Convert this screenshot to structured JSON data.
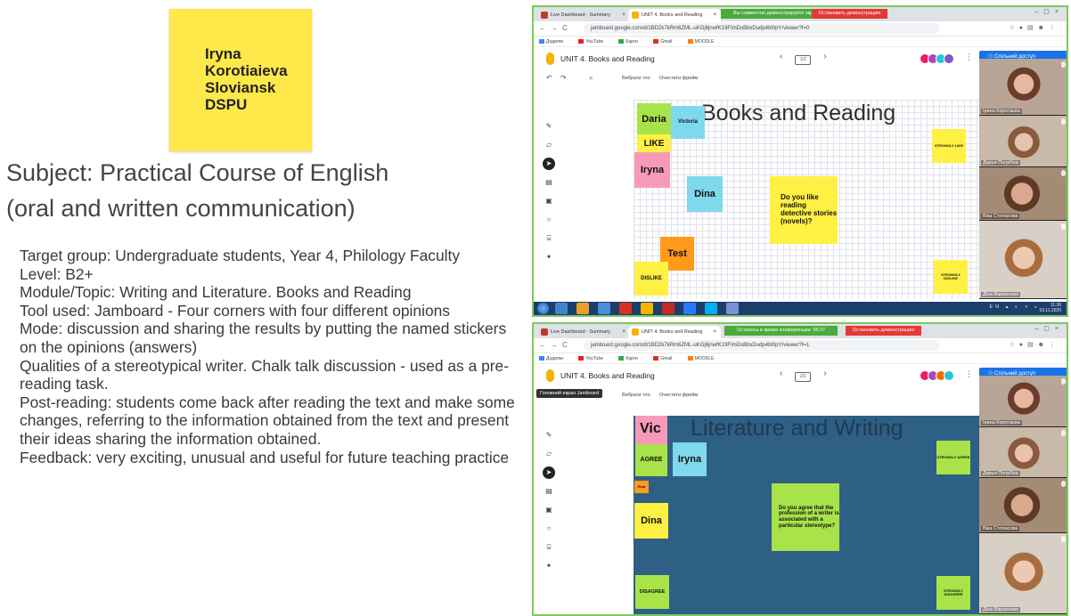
{
  "author": {
    "name_line1": "Iryna",
    "name_line2": "Korotiaieva",
    "affiliation_line1": "Sloviansk",
    "affiliation_line2": "DSPU"
  },
  "subject": {
    "line1": "Subject: Practical Course of English",
    "line2": "(oral and written communication)"
  },
  "details": [
    "Target group: Undergraduate students, Year 4, Philology Faculty",
    "Level: B2+",
    "Module/Topic: Writing and Literature. Books and Reading",
    "Tool used: Jamboard - Four corners with four different opinions",
    "Mode: discussion and sharing the results by putting the named stickers on the opinions (answers)",
    "Qualities of a stereotypical writer. Chalk talk discussion - used as a pre-reading task.",
    "Post-reading:  students come back after reading the text and make some changes, referring to the information obtained from the text and present their ideas sharing the information obtained.",
    "Feedback: very exciting, unusual and useful for future teaching practice"
  ],
  "colors": {
    "frame_border": "#7dc95e",
    "sticky_yellow": "#fff044",
    "sticky_green": "#a8e34a",
    "sticky_pink": "#f79ab7",
    "sticky_blue": "#7fd9ec",
    "sticky_orange": "#ff9a1a",
    "share_blue": "#1a73e8",
    "board_blue": "#2e5f85"
  },
  "browser": {
    "tab1": "Live Dashboard - Summary",
    "tab2": "UNIT 4. Books and Reading",
    "tab2_short": "UNIT 4. Books and Reading",
    "share_banner_1": "Вы совместно демонстрируете экрана",
    "share_banner_2": "Осталось в время конференции: 05:27",
    "stop_banner": "Остановить демонстрацию",
    "url_1": "jamboard.google.com/d/1BD2k7kRm6ZML-uKGj6jnwfK19FImDsBbxDudp4bl0pY/viewer?f=0",
    "url_2": "jamboard.google.com/d/1BD2k7kRm6ZML-uKGj6jnwfK19FImDsBbxDudp4bl0pY/viewer?f=1",
    "bookmarks": [
      "Додатки",
      "YouTube",
      "Карти",
      "Gmail",
      "MOODLE"
    ]
  },
  "jamboard": {
    "title": "UNIT 4. Books and Reading",
    "prev": "‹",
    "next": "›",
    "more": "⋮",
    "share": "Спільний доступ",
    "toolbar_pick": "Вибрати тло",
    "toolbar_clear": "Очистити фрейм",
    "tooltip": "Головний екран Jamboard"
  },
  "board1": {
    "title": "Books and Reading",
    "notes": {
      "daria": "Daria",
      "victoria": "Victoria",
      "like": "LIKE",
      "iryna": "Iryna",
      "dina": "Dina",
      "question": "Do you like reading detective stories (novels)?",
      "test": "Test",
      "dislike": "DISLIKE",
      "strongly_like": "STRONGLY LIKE",
      "strongly_dislike": "STRONGLY DISLIKE"
    }
  },
  "board2": {
    "title": "Literature and Writing",
    "notes": {
      "vic": "Vic",
      "agree": "AGREE",
      "iryna": "Iryna",
      "small": "Ліля",
      "dina": "Dina",
      "question": "Do you agree that the profession of a writer is associated with a particular stereotype?",
      "disagree": "DISAGREE",
      "strongly_agree": "STRONGLY AGREE",
      "strongly_disagree": "STRONGLY DISAGREE"
    }
  },
  "participants_1": [
    "Ірина Коротаєва",
    "Дарья Погрібна",
    "Віка Стопасова",
    "Діна Вараненко"
  ],
  "participants_2": [
    "Ірина Коротаєва",
    "Дарья Погрібна",
    "Віка Стопасова",
    "Діна Вараненко"
  ],
  "taskbar": {
    "lang": "EN",
    "time": "11:36",
    "date": "10.11.2020"
  }
}
